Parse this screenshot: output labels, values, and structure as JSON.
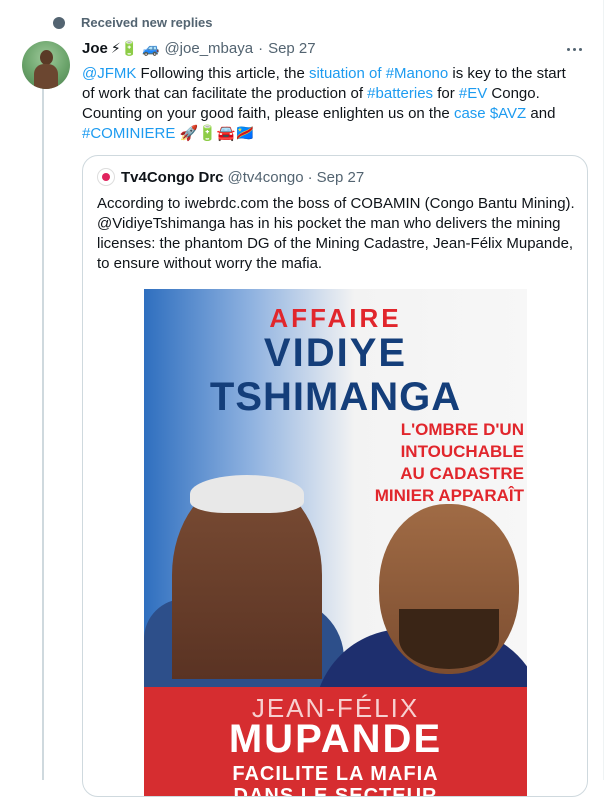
{
  "notice": {
    "text": "Received new replies"
  },
  "tweet": {
    "name": "Joe",
    "name_emojis": "⚡🔋 🚙",
    "handle": "@joe_mbaya",
    "date": "Sep 27",
    "text_parts": [
      "@JFMK",
      " Following this article, the ",
      "situation of",
      " ",
      "#Manono",
      " is key to the start of work that can facilitate the production of ",
      "#batteries",
      " for ",
      "#EV",
      " Congo. Counting on your good faith, please enlighten us on the ",
      "case",
      " ",
      "$AVZ",
      " and ",
      "#COMINIERE",
      " 🚀🔋🚘🇨🇩"
    ]
  },
  "quote": {
    "name": "Tv4Congo Drc",
    "handle": "@tv4congo",
    "date": "Sep 27",
    "text": "According to  iwebrdc.com the boss of COBAMIN (Congo Bantu Mining).  @VidiyeTshimanga has in his pocket the man who delivers the mining licenses: the phantom DG of the Mining Cadastre, Jean-Félix Mupande, to ensure without worry the mafia."
  },
  "poster": {
    "line1": "AFFAIRE",
    "line2": "VIDIYE",
    "line3": "TSHIMANGA",
    "subtitle_lines": [
      "L'OMBRE D'UN",
      "INTOUCHABLE",
      "AU CADASTRE",
      "MINIER APPARAÎT"
    ],
    "banner_name_small": "JEAN-FÉLIX",
    "banner_name_big": "MUPANDE",
    "banner_lines": [
      "FACILITE LA MAFIA",
      "DANS LE SECTEUR"
    ]
  },
  "colors": {
    "link": "#1d9bf0",
    "muted": "#536471",
    "poster_red": "#d62d30",
    "poster_blue": "#143e7a"
  }
}
